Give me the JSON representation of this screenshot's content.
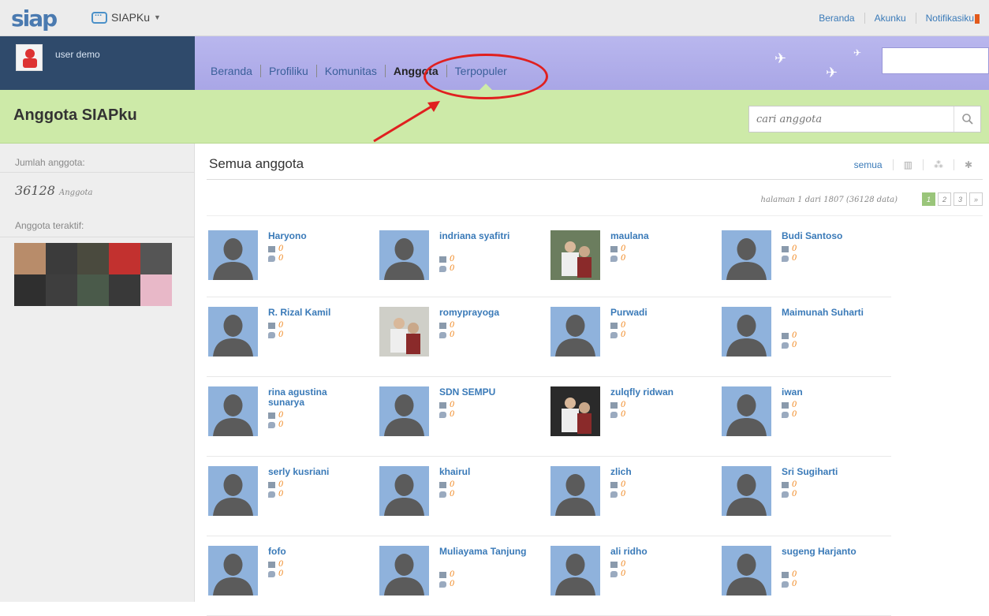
{
  "app": {
    "logo": "siap",
    "switcher_label": "SIAPKu"
  },
  "toplinks": [
    "Beranda",
    "Akunku",
    "Notifikasiku"
  ],
  "user": {
    "name": "user demo"
  },
  "nav": {
    "tabs": [
      "Beranda",
      "Profiliku",
      "Komunitas",
      "Anggota",
      "Terpopuler"
    ],
    "active": "Anggota"
  },
  "page": {
    "title": "Anggota SIAPku",
    "search_placeholder": "cari anggota"
  },
  "sidebar": {
    "count_label": "Jumlah anggota:",
    "count_value": "36128",
    "count_unit": "Anggota",
    "active_label": "Anggota teraktif:"
  },
  "main": {
    "heading": "Semua anggota",
    "filter_all": "semua",
    "pagination_text": "halaman 1 dari 1807 (36128 data)",
    "pages": [
      "1",
      "2",
      "3",
      "»"
    ]
  },
  "members": [
    {
      "name": "Haryono",
      "a": "0",
      "b": "0",
      "photo": false
    },
    {
      "name": "indriana syafitri",
      "a": "0",
      "b": "0",
      "photo": false
    },
    {
      "name": "maulana",
      "a": "0",
      "b": "0",
      "photo": true,
      "tone": "#6b7d5e"
    },
    {
      "name": "Budi Santoso",
      "a": "0",
      "b": "0",
      "photo": false
    },
    {
      "name": "R. Rizal Kamil",
      "a": "0",
      "b": "0",
      "photo": false
    },
    {
      "name": "romyprayoga",
      "a": "0",
      "b": "0",
      "photo": true,
      "tone": "#cfcfc8"
    },
    {
      "name": "Purwadi",
      "a": "0",
      "b": "0",
      "photo": false
    },
    {
      "name": "Maimunah Suharti",
      "a": "0",
      "b": "0",
      "photo": false
    },
    {
      "name": "rina agustina sunarya",
      "a": "0",
      "b": "0",
      "photo": false
    },
    {
      "name": "SDN SEMPU",
      "a": "0",
      "b": "0",
      "photo": false
    },
    {
      "name": "zulqfly ridwan",
      "a": "0",
      "b": "0",
      "photo": true,
      "tone": "#2a2a2a"
    },
    {
      "name": "iwan",
      "a": "0",
      "b": "0",
      "photo": false
    },
    {
      "name": "serly kusriani",
      "a": "0",
      "b": "0",
      "photo": false
    },
    {
      "name": "khairul",
      "a": "0",
      "b": "0",
      "photo": false
    },
    {
      "name": "zlich",
      "a": "0",
      "b": "0",
      "photo": false
    },
    {
      "name": "Sri Sugiharti",
      "a": "0",
      "b": "0",
      "photo": false
    },
    {
      "name": "fofo",
      "a": "0",
      "b": "0",
      "photo": false
    },
    {
      "name": "Muliayama Tanjung",
      "a": "0",
      "b": "0",
      "photo": false
    },
    {
      "name": "ali ridho",
      "a": "0",
      "b": "0",
      "photo": false
    },
    {
      "name": "sugeng Harjanto",
      "a": "0",
      "b": "0",
      "photo": false
    }
  ],
  "active_thumbs": [
    "#b88c6a",
    "#3b3b3b",
    "#4a4a3e",
    "#c2312f",
    "#555555",
    "#2f2f2f",
    "#3e3e3e",
    "#4a5a4a",
    "#393939",
    "#e8b8c8"
  ],
  "colors": {
    "link": "#3a7ab8",
    "accent_green": "#cdeaa8",
    "nav_purple": "#b0aeea",
    "annotation_red": "#e0201f",
    "stat_orange": "#f08a25"
  }
}
